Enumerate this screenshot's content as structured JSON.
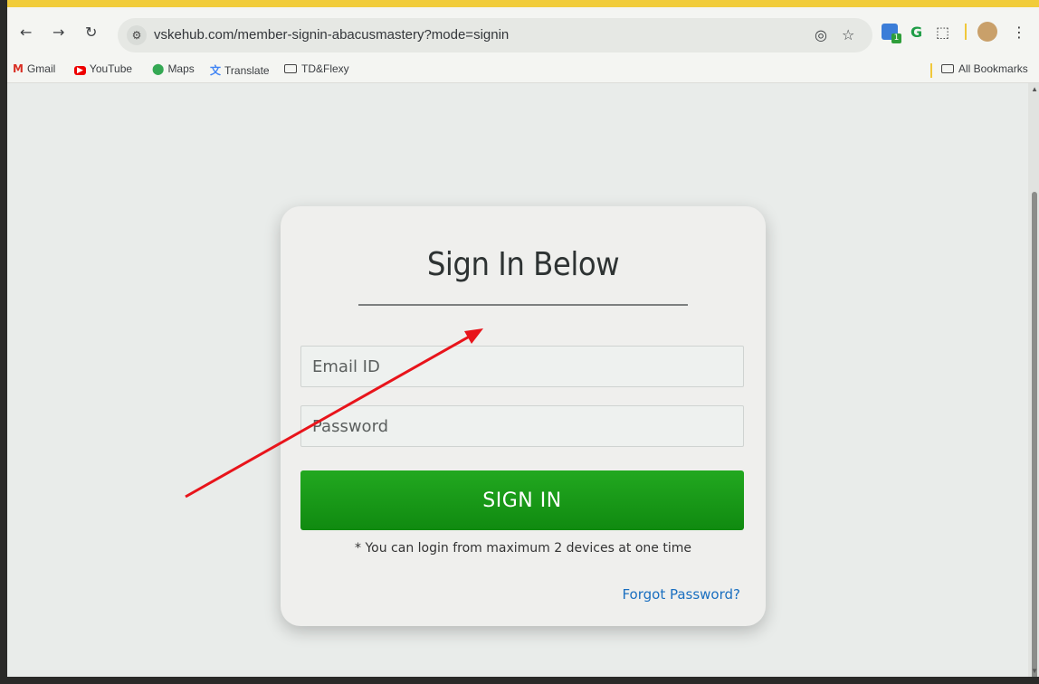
{
  "browser": {
    "url": "vskehub.com/member-signin-abacusmastery?mode=signin",
    "icons": {
      "back": "back-arrow-icon",
      "forward": "forward-arrow-icon",
      "reload": "reload-icon",
      "site_info": "site-info-icon",
      "eye_off": "eye-off-icon",
      "star": "bookmark-star-icon",
      "menu": "more-vert-icon"
    },
    "extension_badge": "1"
  },
  "bookmarks": {
    "items": [
      {
        "label": "Gmail",
        "icon": "gmail-icon"
      },
      {
        "label": "YouTube",
        "icon": "youtube-icon"
      },
      {
        "label": "Maps",
        "icon": "maps-icon"
      },
      {
        "label": "Translate",
        "icon": "translate-icon"
      },
      {
        "label": "TD&Flexy",
        "icon": "folder-icon"
      }
    ],
    "all_bookmarks": "All Bookmarks"
  },
  "signin": {
    "title": "Sign In Below",
    "email_placeholder": "Email ID",
    "password_placeholder": "Password",
    "button_label": "SIGN IN",
    "note": "* You can login from maximum 2 devices at one time",
    "forgot_link": "Forgot Password?"
  },
  "colors": {
    "button_green": "#1a9a18",
    "link_blue": "#1a6fc0",
    "annotation_arrow": "#e8141b"
  }
}
